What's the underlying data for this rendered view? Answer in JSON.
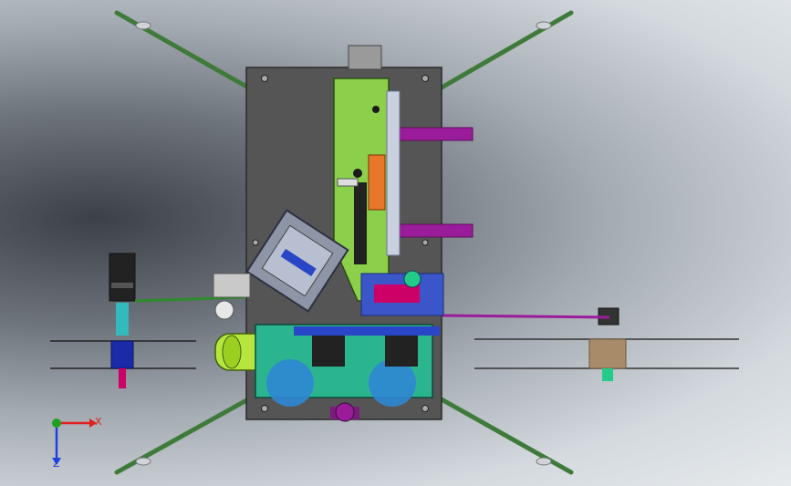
{
  "view": {
    "triad": {
      "x_label": "X",
      "z_label": "Z"
    }
  },
  "colors": {
    "background_dark": "#3c4148",
    "background_light": "#e6eaed",
    "plate": "#555555",
    "legs": "#5fa75a",
    "purple_bar": "#9b1c9b",
    "chassis_green": "#8ccf4a",
    "spool_tan": "#a88c6a",
    "lime": "#b6e63e",
    "axis_x": "#e02020",
    "axis_y": "#20a020",
    "axis_z": "#2040e0"
  }
}
